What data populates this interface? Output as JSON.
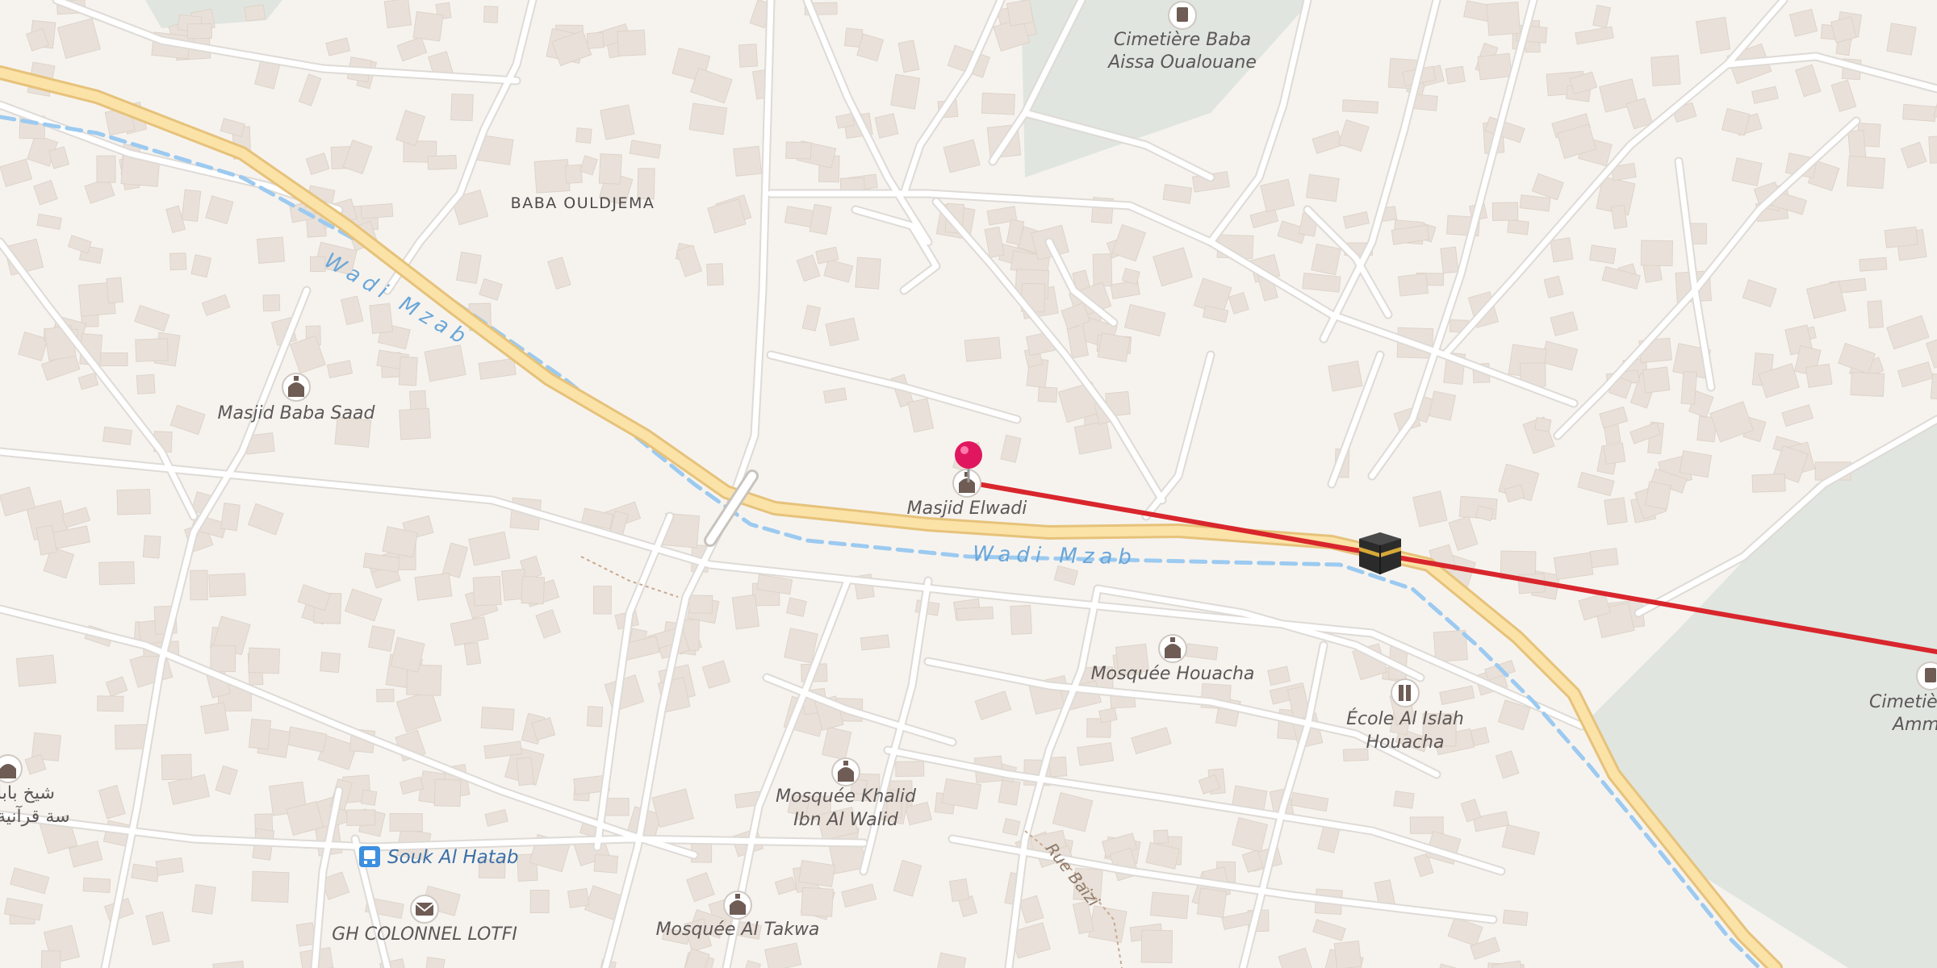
{
  "map": {
    "colors": {
      "land": "#f6f3ef",
      "park": "#e0e5df",
      "building": "#e9e1d9",
      "road": "#ffffff",
      "primary_road": "#fbe2a7",
      "river": "#9ccaf0",
      "route_line": "#d8262c",
      "marker": "#e0175f",
      "poi_icon": "#6e5c55",
      "bus_icon": "#3d8fe0"
    },
    "area_labels": {
      "district": "BABA OULDJEMA"
    },
    "waterways": [
      {
        "name": "Wadi Mzab",
        "id": "upper"
      },
      {
        "name": "Wadi Mzab",
        "id": "lower"
      }
    ],
    "streets": {
      "rue_baizi": "Rue Baizi"
    },
    "pois": {
      "cimetiere_baba": {
        "line1": "Cimetière Baba",
        "line2": "Aissa Oualouane",
        "icon": "cemetery-icon"
      },
      "masjid_baba_saad": {
        "line1": "Masjid Baba Saad",
        "icon": "mosque-icon"
      },
      "masjid_elwadi": {
        "line1": "Masjid Elwadi",
        "icon": "mosque-icon"
      },
      "mosquee_houacha": {
        "line1": "Mosquée Houacha",
        "icon": "mosque-icon"
      },
      "ecole_al_islah": {
        "line1": "École Al Islah",
        "line2": "Houacha",
        "icon": "school-icon"
      },
      "mosquee_khalid": {
        "line1": "Mosquée Khalid",
        "line2": "Ibn Al Walid",
        "icon": "mosque-icon"
      },
      "mosquee_al_takwa": {
        "line1": "Mosquée Al Takwa",
        "icon": "mosque-icon"
      },
      "souk_al_hatab": {
        "line1": "Souk Al Hatab",
        "icon": "bus-stop-icon"
      },
      "gh_colonnel_lotfi": {
        "line1": "GH COLONNEL LOTFI",
        "icon": "post-office-icon"
      },
      "arabic_school": {
        "line1": "شيخ بابا",
        "line2": "سة قرآنية",
        "icon": "mosque-icon"
      },
      "cimetiere_ammi": {
        "line1": "Cimetièr",
        "line2": "Ammi",
        "icon": "cemetery-icon"
      }
    },
    "markers": {
      "location_pin": "location-pin-icon",
      "kaaba": "kaaba-icon"
    },
    "route": {
      "name": "qibla-direction-line"
    }
  }
}
